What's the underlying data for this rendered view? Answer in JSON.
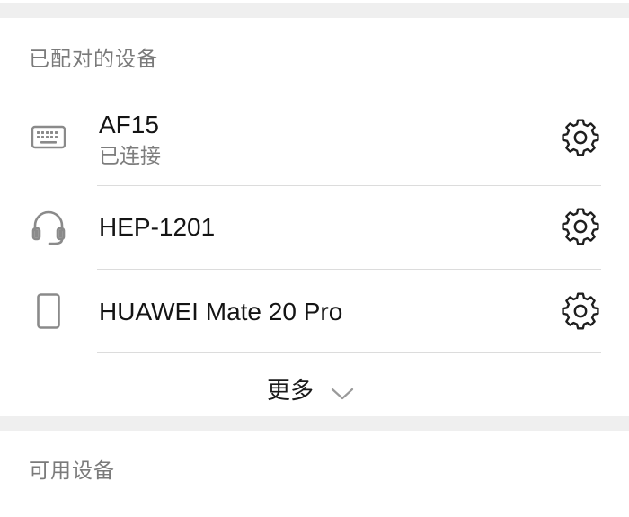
{
  "paired_section": {
    "title": "已配对的设备",
    "devices": [
      {
        "name": "AF15",
        "status": "已连接",
        "icon": "keyboard-icon"
      },
      {
        "name": "HEP-1201",
        "status": "",
        "icon": "headset-icon"
      },
      {
        "name": "HUAWEI Mate 20 Pro",
        "status": "",
        "icon": "phone-icon"
      }
    ],
    "more_label": "更多",
    "settings_icon": "gear-icon"
  },
  "available_section": {
    "title": "可用设备"
  },
  "colors": {
    "background": "#efefef",
    "card": "#ffffff",
    "section_title": "#7a7a7a",
    "primary_text": "#141414",
    "secondary_text": "#7d7d7d",
    "icon": "#8a8a8a",
    "gear": "#1e1e1e",
    "divider": "#dcdcdc"
  }
}
